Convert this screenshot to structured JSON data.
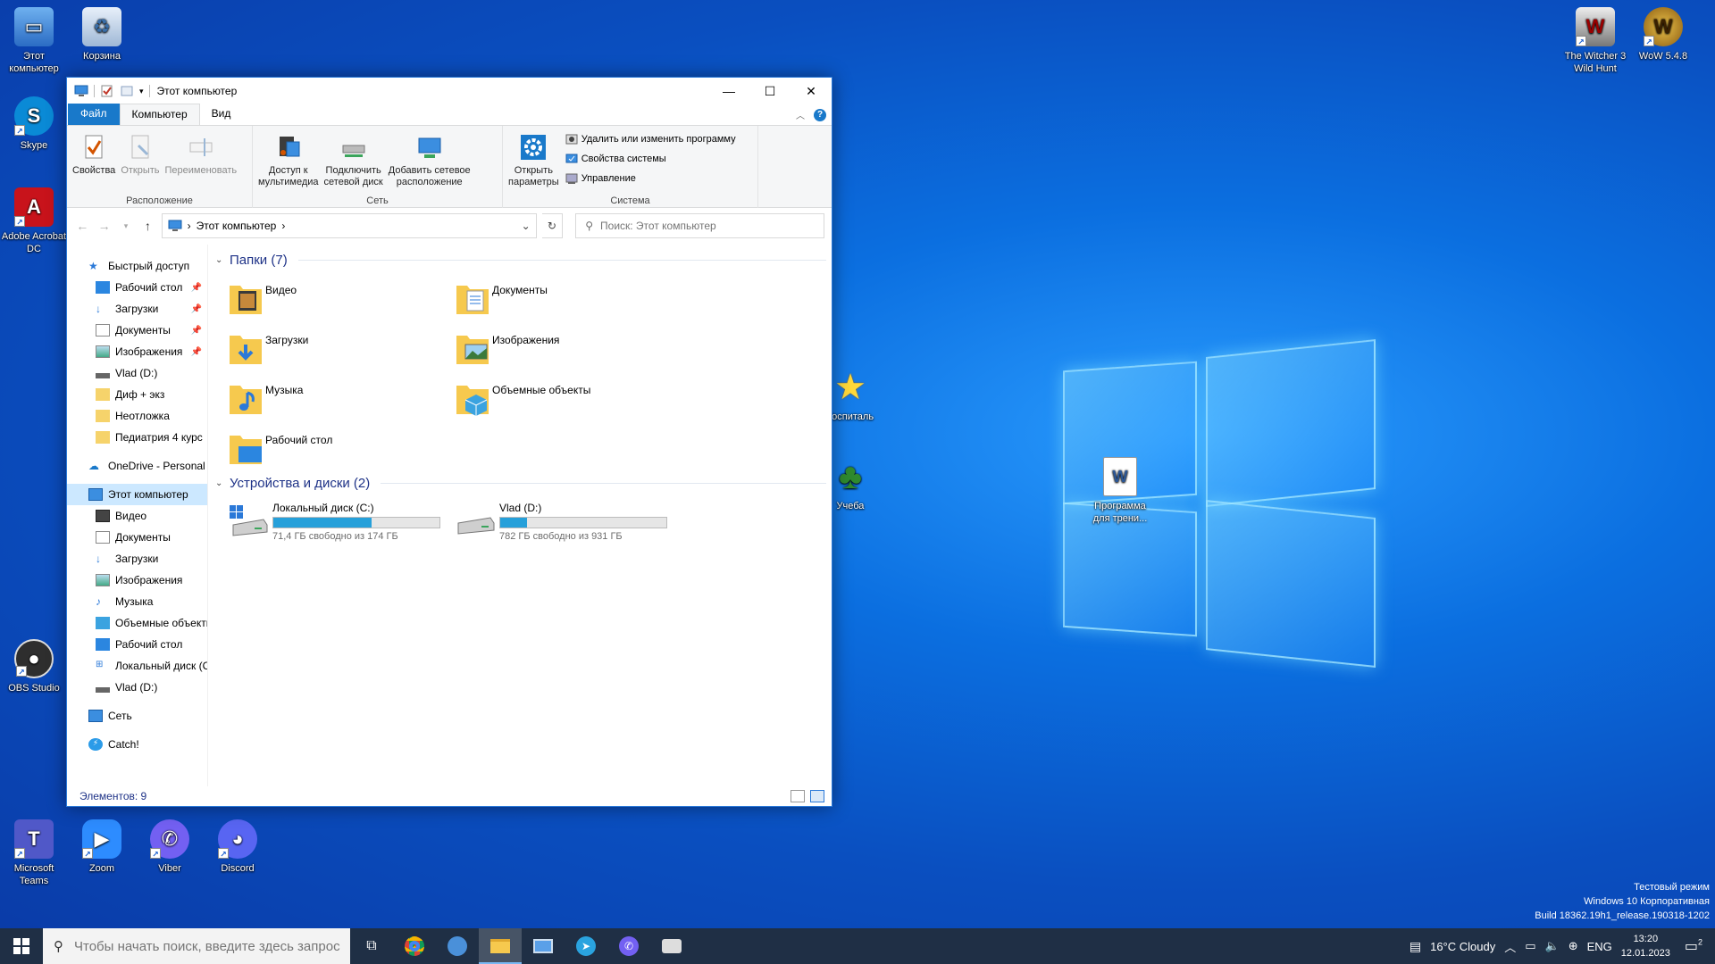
{
  "desktop": {
    "left_icons": [
      {
        "label": "Этот компьютер",
        "color": "#3b7fd6"
      },
      {
        "label": "Корзина",
        "color": "#9fb8d6"
      },
      {
        "label": "Skype",
        "color": "#0a8ad6"
      },
      {
        "label": "Adobe Acrobat DC",
        "color": "#c8131b"
      },
      {
        "label": "OBS Studio",
        "color": "#2e2e2e"
      },
      {
        "label": "Microsoft Teams",
        "color": "#5058c8"
      },
      {
        "label": "Zoom",
        "color": "#2d8cff"
      },
      {
        "label": "Viber",
        "color": "#7360f2"
      },
      {
        "label": "Discord",
        "color": "#5865f2"
      }
    ],
    "right_icons": [
      {
        "label": "The Witcher 3 Wild Hunt"
      },
      {
        "label": "WoW 5.4.8"
      }
    ],
    "mid_icons": [
      {
        "label": "Госпиталь"
      },
      {
        "label": "Учеба"
      },
      {
        "label": "Программа для трени..."
      }
    ],
    "watermark": [
      "Тестовый режим",
      "Windows 10 Корпоративная",
      "Build 18362.19h1_release.190318-1202"
    ]
  },
  "window": {
    "title": "Этот компьютер",
    "tabs": {
      "file": "Файл",
      "computer": "Компьютер",
      "view": "Вид"
    },
    "ribbon": {
      "location": {
        "label": "Расположение",
        "properties": "Свойства",
        "open": "Открыть",
        "rename": "Переименовать"
      },
      "network": {
        "label": "Сеть",
        "media_1": "Доступ к",
        "media_2": "мультимедиа",
        "map_1": "Подключить",
        "map_2": "сетевой диск",
        "add_1": "Добавить сетевое",
        "add_2": "расположение"
      },
      "system": {
        "label": "Система",
        "settings_1": "Открыть",
        "settings_2": "параметры",
        "uninstall": "Удалить или изменить программу",
        "sys_props": "Свойства системы",
        "manage": "Управление"
      }
    },
    "address": {
      "path": "Этот компьютер"
    },
    "search": {
      "placeholder": "Поиск: Этот компьютер"
    },
    "nav": {
      "quick": "Быстрый доступ",
      "quick_items": [
        "Рабочий стол",
        "Загрузки",
        "Документы",
        "Изображения",
        "Vlad (D:)",
        "Диф + экз",
        "Неотложка",
        "Педиатрия 4 курс"
      ],
      "onedrive": "OneDrive - Personal",
      "thispc": "Этот компьютер",
      "pc_items": [
        "Видео",
        "Документы",
        "Загрузки",
        "Изображения",
        "Музыка",
        "Объемные объекты",
        "Рабочий стол",
        "Локальный диск (C:)",
        "Vlad (D:)"
      ],
      "network": "Сеть",
      "catch": "Catch!"
    },
    "folders_header": "Папки (7)",
    "folders": [
      "Видео",
      "Документы",
      "Загрузки",
      "Изображения",
      "Музыка",
      "Объемные объекты",
      "Рабочий стол"
    ],
    "devices_header": "Устройства и диски (2)",
    "drives": [
      {
        "name": "Локальный диск (C:)",
        "free": "71,4 ГБ свободно из 174 ГБ",
        "used_fraction": 0.59
      },
      {
        "name": "Vlad (D:)",
        "free": "782 ГБ свободно из 931 ГБ",
        "used_fraction": 0.16
      }
    ],
    "status": "Элементов: 9"
  },
  "taskbar": {
    "search_placeholder": "Чтобы начать поиск, введите здесь запрос",
    "weather": "16°C  Cloudy",
    "lang": "ENG",
    "time": "13:20",
    "date": "12.01.2023",
    "notif_count": "2"
  }
}
